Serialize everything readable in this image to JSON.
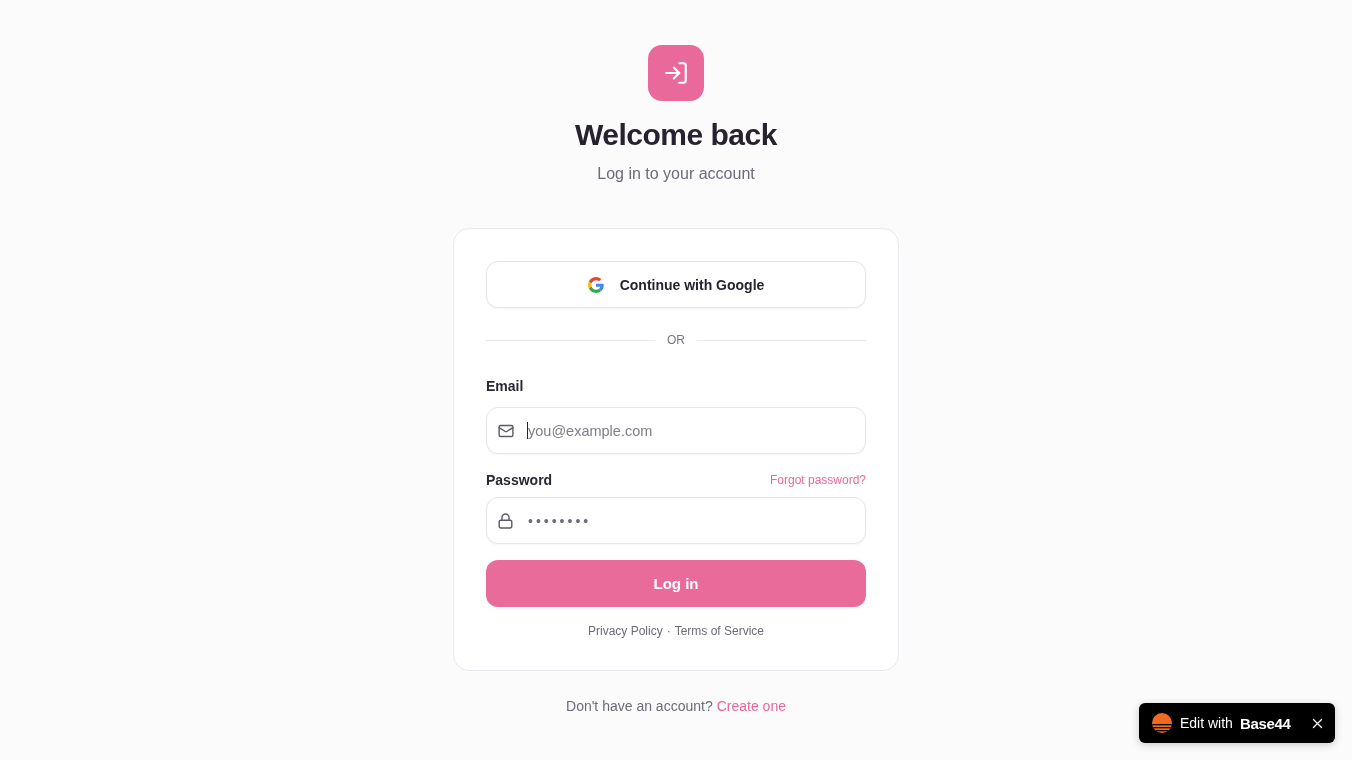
{
  "header": {
    "title": "Welcome back",
    "subtitle": "Log in to your account"
  },
  "card": {
    "google_button": {
      "label": "Continue with Google"
    },
    "divider": {
      "label": "OR"
    },
    "fields": [
      {
        "kind": "email",
        "label": "Email",
        "placeholder": "you@example.com",
        "focused": true
      },
      {
        "kind": "password",
        "label": "Password",
        "link": "Forgot password?",
        "value": "••••••••",
        "focused": false
      }
    ],
    "submit_button": {
      "label": "Log in"
    },
    "footer_links": [
      {
        "label": "Privacy Policy"
      },
      {
        "label": "Terms of Service"
      }
    ],
    "footer_separator": "·"
  },
  "signup_prompt": {
    "text": "Don't have an account?",
    "link": "Create one"
  },
  "edit_badge": {
    "label": "Edit with",
    "brand": "Base44"
  }
}
